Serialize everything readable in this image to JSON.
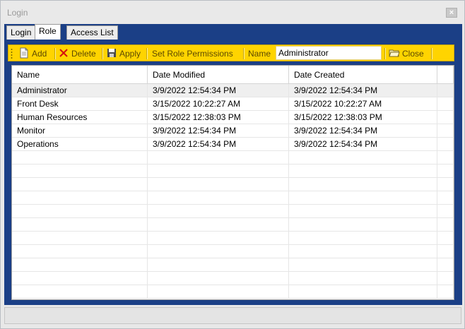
{
  "window": {
    "title": "Login",
    "close_glyph": "×"
  },
  "tabs": [
    {
      "label": "Login",
      "active": false
    },
    {
      "label": "Role",
      "active": true
    },
    {
      "label": "Access List",
      "active": false
    }
  ],
  "toolbar": {
    "add_label": "Add",
    "delete_label": "Delete",
    "apply_label": "Apply",
    "permissions_label": "Set Role Permissions",
    "name_label": "Name",
    "name_value": "Administrator",
    "close_label": "Close",
    "add_icon": "new-document-icon",
    "delete_icon": "red-x-icon",
    "apply_icon": "floppy-disk-icon",
    "close_icon": "open-folder-icon",
    "accent_color": "#ffd400"
  },
  "grid": {
    "columns": [
      "Name",
      "Date Modified",
      "Date Created"
    ],
    "rows": [
      {
        "name": "Administrator",
        "modified": "3/9/2022 12:54:34 PM",
        "created": "3/9/2022 12:54:34 PM",
        "selected": true
      },
      {
        "name": "Front Desk",
        "modified": "3/15/2022 10:22:27 AM",
        "created": "3/15/2022 10:22:27 AM",
        "selected": false
      },
      {
        "name": "Human Resources",
        "modified": "3/15/2022 12:38:03 PM",
        "created": "3/15/2022 12:38:03 PM",
        "selected": false
      },
      {
        "name": "Monitor",
        "modified": "3/9/2022 12:54:34 PM",
        "created": "3/9/2022 12:54:34 PM",
        "selected": false
      },
      {
        "name": "Operations",
        "modified": "3/9/2022 12:54:34 PM",
        "created": "3/9/2022 12:54:34 PM",
        "selected": false
      }
    ]
  },
  "colors": {
    "frame": "#1b3f86",
    "toolbar": "#ffd400",
    "selected_row": "#efefef"
  }
}
